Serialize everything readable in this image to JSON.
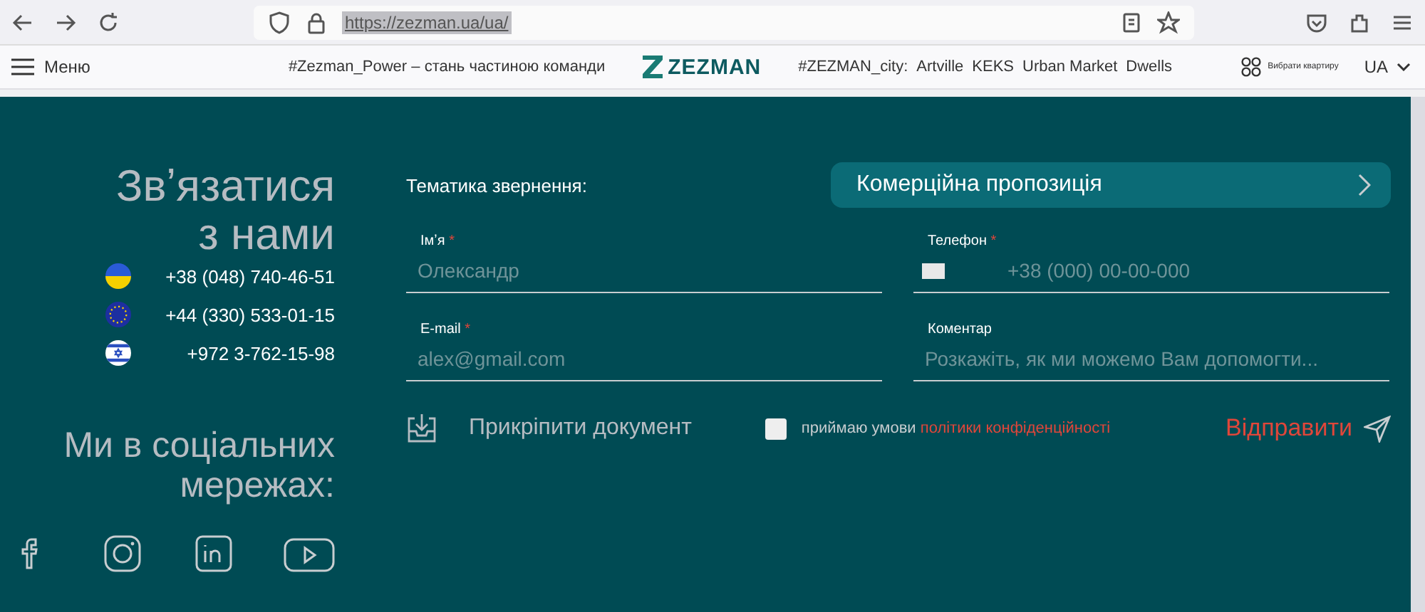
{
  "browser": {
    "url": "https://zezman.ua/ua/"
  },
  "header": {
    "menu_label": "Меню",
    "slogan": "#Zezman_Power – стань частиною команди",
    "logo": "ZEZMAN",
    "city_label": "#ZEZMAN_city:",
    "city_links": [
      "Artville",
      "KEKS",
      "Urban Market",
      "Dwells"
    ],
    "choose_flat": "Вибрати квартиру",
    "language": "UA"
  },
  "contacts": {
    "title": "Звʼязатися з нами",
    "phones": [
      {
        "kind": "ua",
        "number": "+38 (048) 740-46-51"
      },
      {
        "kind": "eu",
        "number": "+44 (330) 533-01-15"
      },
      {
        "kind": "il",
        "number": "+972 3-762-15-98"
      }
    ],
    "social_title": "Ми в соціальних мережах:",
    "social": [
      {
        "kind": "facebook"
      },
      {
        "kind": "instagram"
      },
      {
        "kind": "linkedin"
      },
      {
        "kind": "youtube"
      }
    ]
  },
  "form": {
    "topic_label": "Тематика звернення:",
    "topic_value": "Комерційна пропозиція",
    "fields": [
      {
        "kind": "text",
        "label": "Імʼя",
        "mark": "*",
        "placeholder": "Олександр"
      },
      {
        "kind": "phone",
        "label": "Телефон",
        "mark": "*",
        "placeholder": "+38 (000) 00-00-000"
      },
      {
        "kind": "text",
        "label": "E-mail",
        "mark": "*",
        "placeholder": "alex@gmail.com"
      },
      {
        "kind": "text",
        "label": "Коментар",
        "placeholder": "Розкажіть, як ми можемо Вам допомогти..."
      }
    ],
    "attach_label": "Прикріпити документ",
    "consent": {
      "checked": false,
      "text": "приймаю умови",
      "link": "політики конфіденційності"
    },
    "submit": "Відправити"
  }
}
